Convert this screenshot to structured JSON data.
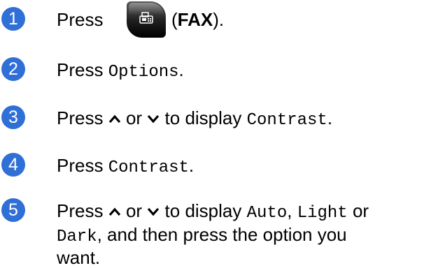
{
  "steps": [
    {
      "number": "1",
      "press": "Press",
      "button_name": "FAX",
      "paren_open": "(",
      "paren_close": ")."
    },
    {
      "number": "2",
      "press": "Press",
      "option": "Options",
      "end": "."
    },
    {
      "number": "3",
      "press": "Press",
      "or": "or",
      "to_display": "to display",
      "option": "Contrast",
      "end": "."
    },
    {
      "number": "4",
      "press": "Press",
      "option": "Contrast",
      "end": "."
    },
    {
      "number": "5",
      "press": "Press",
      "or": "or",
      "to_display": "to display",
      "opt_auto": "Auto",
      "comma": ",",
      "opt_light": "Light",
      "or2": "or",
      "opt_dark": "Dark",
      "rest_line2": ", and then press the option you",
      "line3": "want."
    }
  ],
  "icons": {
    "step_number_color": "#2f6fd6",
    "fax_button_icon": "fax-icon",
    "up_arrow": "chevron-up-icon",
    "down_arrow": "chevron-down-icon"
  }
}
